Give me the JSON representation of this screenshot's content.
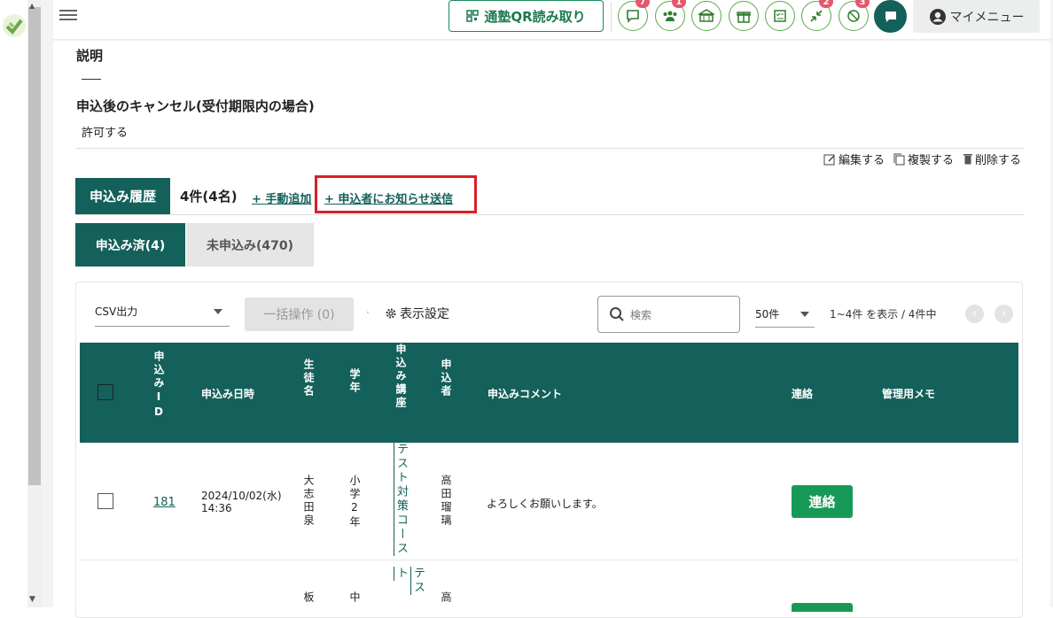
{
  "colors": {
    "primary": "#14605a",
    "accent_green": "#179a57",
    "badge": "#e4576e",
    "highlight": "#d81e27"
  },
  "header": {
    "qr_label": "通塾QR読み取り",
    "badges": {
      "chat": "7",
      "members": "1",
      "alerts": "2",
      "disabled": "3"
    },
    "my_menu": "マイメニュー"
  },
  "details": {
    "description_label": "説明",
    "cancel_label": "申込後のキャンセル(受付期限内の場合)",
    "cancel_value": "許可する"
  },
  "actions": {
    "edit": "編集する",
    "copy": "複製する",
    "delete": "削除する"
  },
  "history": {
    "tab_label": "申込み履歴",
    "count": "4件(4名)",
    "manual_add": "+ 手動追加",
    "notify": "+ 申込者にお知らせ送信"
  },
  "subtabs": {
    "applied": "申込み済(4)",
    "not_applied": "未申込み(470)"
  },
  "toolbar": {
    "csv": "CSV出力",
    "bulk": "一括操作 (0)",
    "separator": "·",
    "display_settings": "表示設定",
    "search_placeholder": "検索",
    "per_page": "50件",
    "range": "1~4件 を表示 / 4件中"
  },
  "table": {
    "headers": {
      "id": "申込みID",
      "date": "申込み日時",
      "student": "生徒名",
      "grade": "学年",
      "course": "申込み講座",
      "applicant": "申込者",
      "comment": "申込みコメント",
      "contact": "連絡",
      "memo": "管理用メモ"
    },
    "rows": [
      {
        "id": "181",
        "date": "2024/10/02(水)",
        "time": "14:36",
        "student": "大志田泉",
        "grade": "小学2年",
        "course": "テスト対策コース",
        "applicant": "高田瑠璃",
        "comment": "よろしくお願いします。",
        "contact": "連絡"
      },
      {
        "student": "板",
        "grade": "中",
        "course": "テスト",
        "applicant": "高"
      }
    ]
  }
}
